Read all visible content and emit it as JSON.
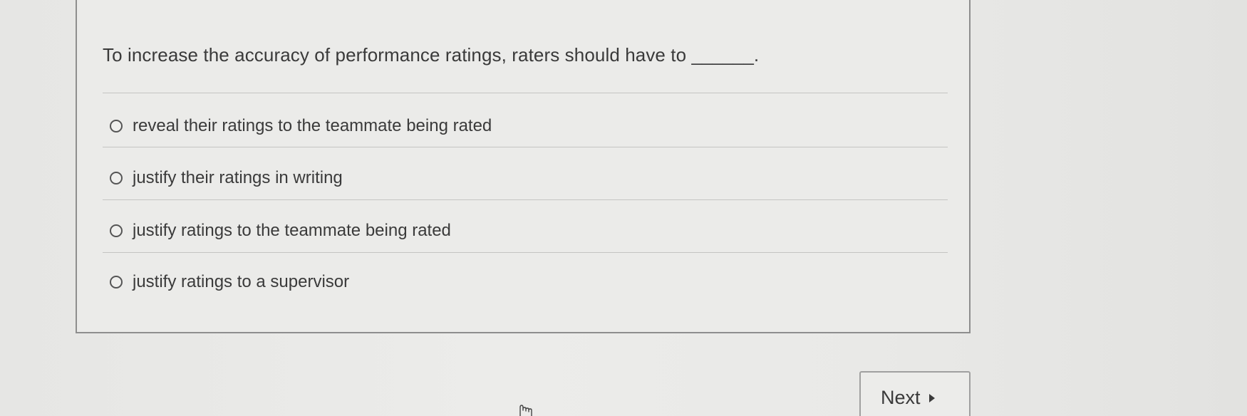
{
  "question": {
    "text": "To increase the accuracy of performance ratings, raters should have to ______."
  },
  "options": [
    {
      "label": "reveal their ratings to the teammate being rated",
      "selected": false
    },
    {
      "label": "justify their ratings in writing",
      "selected": false
    },
    {
      "label": "justify ratings to the teammate being rated",
      "selected": false
    },
    {
      "label": "justify ratings to a supervisor",
      "selected": false
    }
  ],
  "navigation": {
    "next_label": "Next",
    "next_icon": "triangle-right-icon"
  },
  "cursor": {
    "icon": "hand-pointer-icon"
  }
}
